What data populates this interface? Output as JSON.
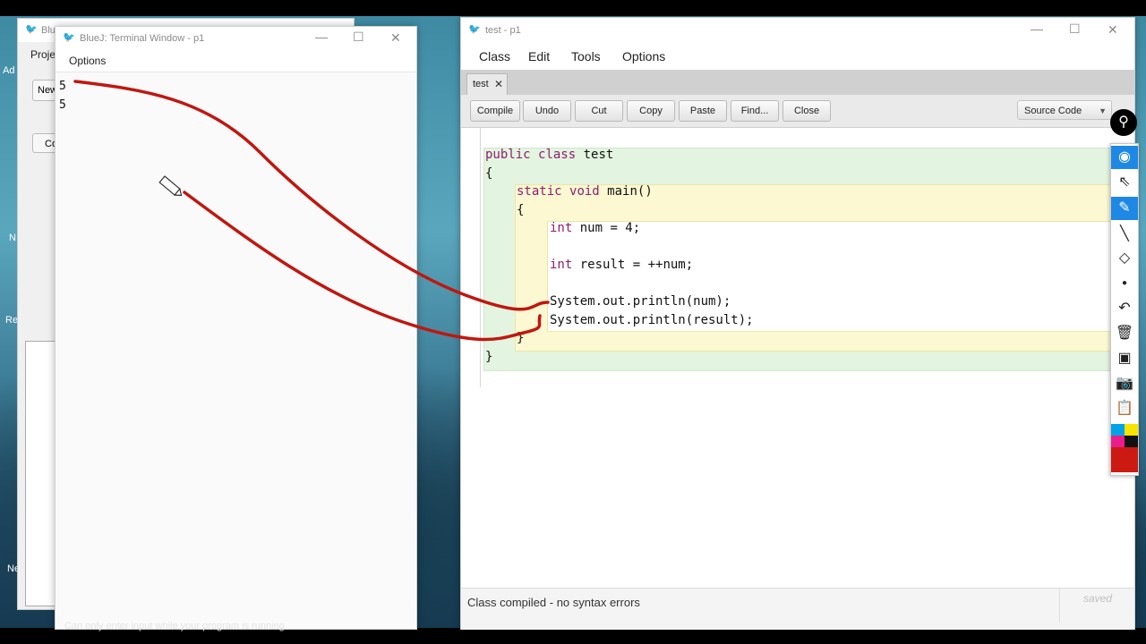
{
  "desktop": {
    "labels": [
      "Ad",
      "Re",
      "N",
      "Ne"
    ]
  },
  "back_window": {
    "title": "Blu",
    "menu": "Proje",
    "buttons": [
      "New",
      "Co"
    ]
  },
  "terminal": {
    "title": "BlueJ: Terminal Window - p1",
    "menu_options": "Options",
    "output": [
      "5",
      "5"
    ],
    "input_hint": "Can only enter input while your program is running"
  },
  "editor": {
    "title": "test - p1",
    "menu": [
      "Class",
      "Edit",
      "Tools",
      "Options"
    ],
    "tab": {
      "label": "test",
      "close": "✕"
    },
    "toolbar": {
      "compile": "Compile",
      "undo": "Undo",
      "cut": "Cut",
      "copy": "Copy",
      "paste": "Paste",
      "find": "Find...",
      "close": "Close",
      "view_select": "Source Code"
    },
    "code": {
      "class_decl_kw1": "public",
      "class_decl_kw2": "class",
      "class_name": "test",
      "brace_open": "{",
      "method_kw1": "static",
      "method_kw2": "void",
      "method_sig": "main()",
      "method_brace_open": "{",
      "line_num_kw": "int",
      "line_num_rest": "num = 4;",
      "line_result_kw": "int",
      "line_result_rest": "result = ++num;",
      "line_print1": "System.out.println(num);",
      "line_print2": "System.out.println(result);",
      "method_brace_close": "}",
      "brace_close": "}"
    },
    "status": "Class compiled - no syntax errors",
    "saved_label": "saved"
  },
  "window_controls": {
    "minimize": "—",
    "maximize": "☐",
    "close": "✕"
  },
  "annotation_toolbar": {
    "tools": [
      "pin-icon",
      "eye-icon",
      "cursor-icon",
      "pen-icon",
      "line-icon",
      "eraser-icon",
      "dot-icon",
      "undo-icon",
      "trash-icon",
      "board-icon",
      "camera-icon",
      "clipboard-icon"
    ],
    "active_tool": "pen-icon",
    "colors": [
      "#00a2e8",
      "#f7e400",
      "#e91e8c",
      "#111111",
      "#cc1a12"
    ]
  },
  "drawing_color": "#c0170f"
}
